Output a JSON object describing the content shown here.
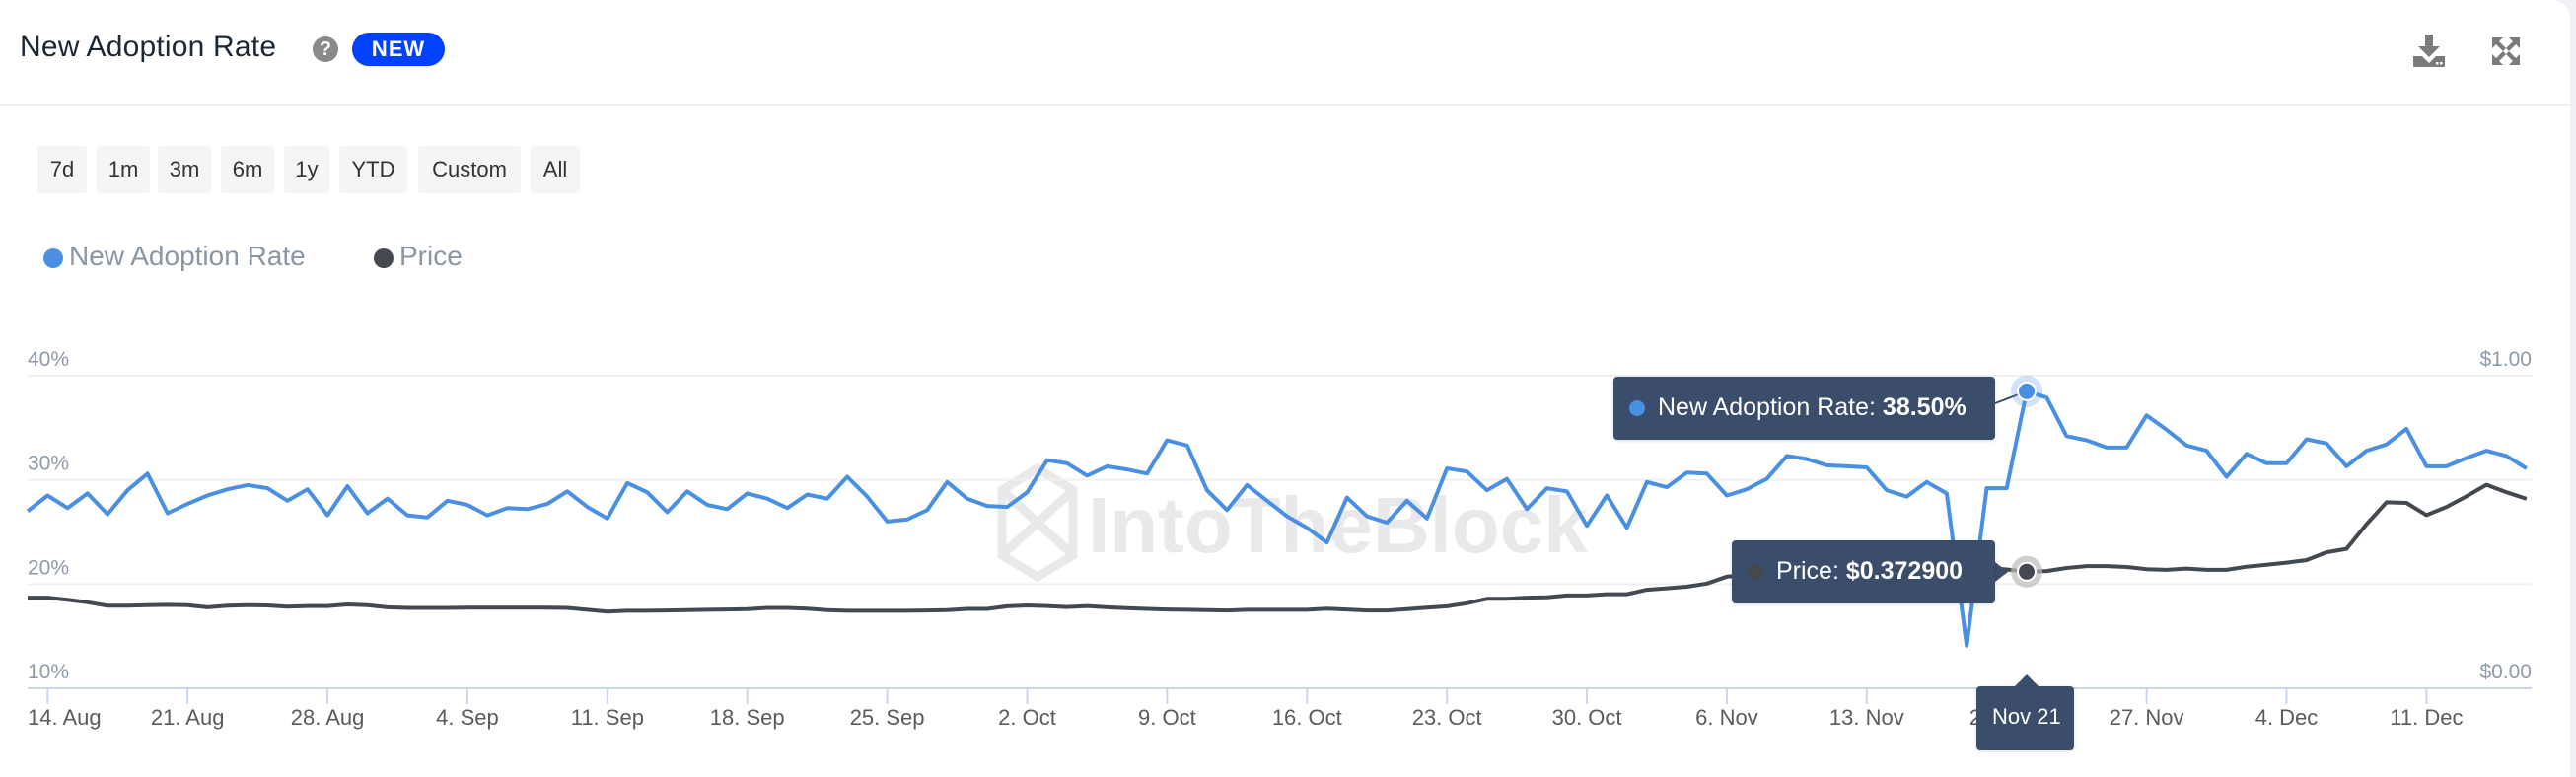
{
  "header": {
    "title": "New Adoption Rate",
    "help_icon": "question-circle-icon",
    "badge": "NEW",
    "badge_color": "#0241fe",
    "download_icon": "download-icon",
    "expand_icon": "expand-icon"
  },
  "range_buttons": [
    "7d",
    "1m",
    "3m",
    "6m",
    "1y",
    "YTD",
    "Custom",
    "All"
  ],
  "legend": [
    {
      "label": "New Adoption Rate",
      "color": "#4a90e2"
    },
    {
      "label": "Price",
      "color": "#444950"
    }
  ],
  "watermark": "IntoTheBlock",
  "tooltip": {
    "date": "Nov 21",
    "adoption_label": "New Adoption Rate: ",
    "adoption_value": "38.50%",
    "price_label": "Price: ",
    "price_value": "$0.372900"
  },
  "chart_data": {
    "type": "line",
    "title": "New Adoption Rate",
    "x_start": "2023-08-13",
    "x_end": "2023-12-16",
    "x_ticks": [
      "14. Aug",
      "21. Aug",
      "28. Aug",
      "4. Sep",
      "11. Sep",
      "18. Sep",
      "25. Sep",
      "2. Oct",
      "9. Oct",
      "16. Oct",
      "23. Oct",
      "30. Oct",
      "6. Nov",
      "13. Nov",
      "20. Nov",
      "27. Nov",
      "4. Dec",
      "11. Dec"
    ],
    "y_left": {
      "label": "New Adoption Rate",
      "ticks": [
        "10%",
        "20%",
        "30%",
        "40%"
      ],
      "range": [
        10,
        40
      ]
    },
    "y_right": {
      "label": "Price",
      "ticks": [
        "$0.00",
        "$1.00"
      ],
      "range": [
        0,
        1
      ]
    },
    "grid": true,
    "legend_position": "top-left",
    "highlight": {
      "date": "Nov 21",
      "index": 100
    },
    "series": [
      {
        "name": "New Adoption Rate",
        "axis": "left",
        "unit": "%",
        "color": "#4a90e2",
        "values": [
          27.0,
          28.5,
          27.3,
          28.7,
          26.7,
          29.0,
          30.6,
          26.8,
          27.7,
          28.5,
          29.1,
          29.5,
          29.2,
          28.0,
          29.1,
          26.6,
          29.4,
          26.8,
          28.2,
          26.6,
          26.4,
          28.0,
          27.6,
          26.6,
          27.3,
          27.2,
          27.7,
          28.9,
          27.4,
          26.3,
          29.7,
          28.8,
          26.9,
          28.9,
          27.6,
          27.2,
          28.7,
          28.2,
          27.3,
          28.6,
          28.2,
          30.3,
          28.4,
          26.0,
          26.2,
          27.1,
          29.8,
          28.2,
          27.5,
          27.4,
          28.8,
          31.9,
          31.6,
          30.4,
          31.3,
          31.0,
          30.6,
          33.8,
          33.3,
          29.0,
          27.1,
          29.5,
          28.0,
          26.5,
          25.4,
          24.0,
          28.3,
          26.5,
          25.9,
          28.0,
          26.3,
          31.1,
          30.8,
          29.0,
          30.1,
          27.2,
          29.2,
          28.9,
          25.6,
          28.5,
          25.4,
          29.8,
          29.3,
          30.7,
          30.6,
          28.5,
          29.1,
          30.1,
          32.3,
          32.0,
          31.4,
          31.3,
          31.2,
          29.0,
          28.4,
          29.8,
          28.7,
          14.1,
          29.2,
          29.2,
          38.5,
          37.9,
          34.2,
          33.8,
          33.1,
          33.1,
          36.2,
          34.8,
          33.3,
          32.8,
          30.3,
          32.5,
          31.6,
          31.6,
          33.9,
          33.5,
          31.3,
          32.8,
          33.4,
          34.9,
          31.3,
          31.3,
          32.1,
          32.8,
          32.3,
          31.1
        ]
      },
      {
        "name": "Price",
        "axis": "right",
        "unit": "$",
        "color": "#444950",
        "values": [
          0.29,
          0.29,
          0.283,
          0.275,
          0.264,
          0.264,
          0.266,
          0.267,
          0.266,
          0.259,
          0.264,
          0.266,
          0.265,
          0.261,
          0.263,
          0.263,
          0.268,
          0.266,
          0.259,
          0.257,
          0.257,
          0.257,
          0.258,
          0.258,
          0.258,
          0.258,
          0.258,
          0.257,
          0.251,
          0.245,
          0.248,
          0.248,
          0.249,
          0.25,
          0.251,
          0.252,
          0.253,
          0.257,
          0.257,
          0.255,
          0.25,
          0.248,
          0.248,
          0.248,
          0.248,
          0.249,
          0.25,
          0.254,
          0.254,
          0.262,
          0.265,
          0.263,
          0.26,
          0.263,
          0.259,
          0.256,
          0.254,
          0.252,
          0.251,
          0.25,
          0.249,
          0.251,
          0.251,
          0.251,
          0.251,
          0.255,
          0.252,
          0.249,
          0.249,
          0.253,
          0.258,
          0.262,
          0.272,
          0.286,
          0.286,
          0.29,
          0.291,
          0.297,
          0.297,
          0.301,
          0.301,
          0.315,
          0.32,
          0.325,
          0.335,
          0.357,
          0.362,
          0.366,
          0.37,
          0.372,
          0.374,
          0.376,
          0.378,
          0.379,
          0.38,
          0.382,
          0.383,
          0.384,
          0.385,
          0.38,
          0.3729,
          0.375,
          0.385,
          0.391,
          0.391,
          0.388,
          0.381,
          0.379,
          0.383,
          0.379,
          0.379,
          0.389,
          0.395,
          0.402,
          0.41,
          0.435,
          0.446,
          0.525,
          0.595,
          0.593,
          0.554,
          0.58,
          0.614,
          0.651,
          0.627,
          0.606
        ]
      }
    ]
  }
}
